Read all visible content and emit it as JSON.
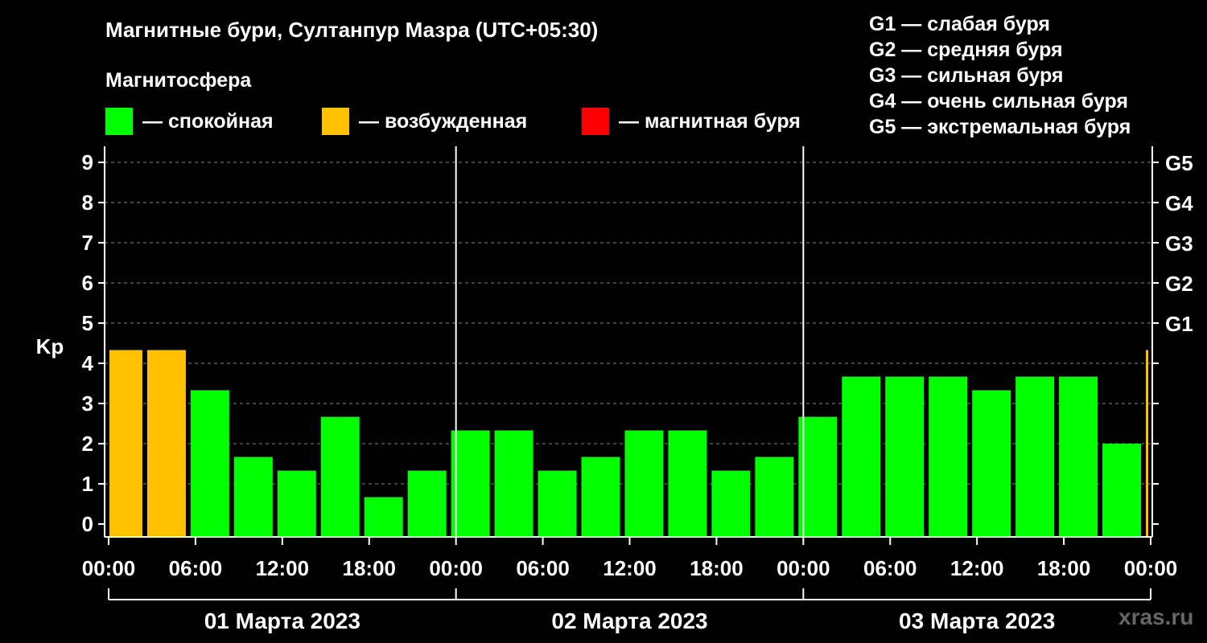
{
  "title": "Магнитные бури, Султанпур Мазра (UTC+05:30)",
  "magnetosphere": {
    "label": "Магнитосфера",
    "items": [
      {
        "label": "— спокойная",
        "color": "#00ff00"
      },
      {
        "label": "— возбужденная",
        "color": "#ffc000"
      },
      {
        "label": "— магнитная буря",
        "color": "#ff0000"
      }
    ]
  },
  "g_legend": [
    "G1 — слабая буря",
    "G2 — средняя буря",
    "G3 — сильная буря",
    "G4 — очень сильная буря",
    "G5 — экстремальная буря"
  ],
  "watermark": "xras.ru",
  "chart_data": {
    "type": "bar",
    "ylabel": "Kp",
    "ylim": [
      0,
      9
    ],
    "yticks": [
      "0",
      "1",
      "2",
      "3",
      "4",
      "5",
      "6",
      "7",
      "8",
      "9"
    ],
    "right_ticks": [
      {
        "y": 5,
        "label": "G1"
      },
      {
        "y": 6,
        "label": "G2"
      },
      {
        "y": 7,
        "label": "G3"
      },
      {
        "y": 8,
        "label": "G4"
      },
      {
        "y": 9,
        "label": "G5"
      }
    ],
    "xticks": [
      "00:00",
      "06:00",
      "12:00",
      "18:00",
      "00:00",
      "06:00",
      "12:00",
      "18:00",
      "00:00",
      "06:00",
      "12:00",
      "18:00",
      "00:00"
    ],
    "dates": [
      "01 Марта 2023",
      "02 Марта 2023",
      "03 Марта 2023"
    ],
    "grid": "dashed horizontal",
    "bars": [
      {
        "start": "01 Марта 2023 00:00",
        "end": "01 Марта 2023 02:30",
        "kp": 4.33,
        "color": "#ffc000"
      },
      {
        "start": "01 Марта 2023 02:30",
        "end": "01 Марта 2023 05:30",
        "kp": 4.33,
        "color": "#ffc000"
      },
      {
        "start": "01 Марта 2023 05:30",
        "end": "01 Марта 2023 08:30",
        "kp": 3.33,
        "color": "#00ff00"
      },
      {
        "start": "01 Марта 2023 08:30",
        "end": "01 Марта 2023 11:30",
        "kp": 1.67,
        "color": "#00ff00"
      },
      {
        "start": "01 Марта 2023 11:30",
        "end": "01 Марта 2023 14:30",
        "kp": 1.33,
        "color": "#00ff00"
      },
      {
        "start": "01 Марта 2023 14:30",
        "end": "01 Марта 2023 17:30",
        "kp": 2.67,
        "color": "#00ff00"
      },
      {
        "start": "01 Марта 2023 17:30",
        "end": "01 Марта 2023 20:30",
        "kp": 0.67,
        "color": "#00ff00"
      },
      {
        "start": "01 Марта 2023 20:30",
        "end": "01 Марта 2023 23:30",
        "kp": 1.33,
        "color": "#00ff00"
      },
      {
        "start": "01 Марта 2023 23:30",
        "end": "02 Марта 2023 02:30",
        "kp": 2.33,
        "color": "#00ff00"
      },
      {
        "start": "02 Марта 2023 02:30",
        "end": "02 Марта 2023 05:30",
        "kp": 2.33,
        "color": "#00ff00"
      },
      {
        "start": "02 Марта 2023 05:30",
        "end": "02 Марта 2023 08:30",
        "kp": 1.33,
        "color": "#00ff00"
      },
      {
        "start": "02 Марта 2023 08:30",
        "end": "02 Марта 2023 11:30",
        "kp": 1.67,
        "color": "#00ff00"
      },
      {
        "start": "02 Марта 2023 11:30",
        "end": "02 Марта 2023 14:30",
        "kp": 2.33,
        "color": "#00ff00"
      },
      {
        "start": "02 Марта 2023 14:30",
        "end": "02 Марта 2023 17:30",
        "kp": 2.33,
        "color": "#00ff00"
      },
      {
        "start": "02 Марта 2023 17:30",
        "end": "02 Марта 2023 20:30",
        "kp": 1.33,
        "color": "#00ff00"
      },
      {
        "start": "02 Марта 2023 20:30",
        "end": "02 Марта 2023 23:30",
        "kp": 1.67,
        "color": "#00ff00"
      },
      {
        "start": "02 Марта 2023 23:30",
        "end": "03 Марта 2023 02:30",
        "kp": 2.67,
        "color": "#00ff00"
      },
      {
        "start": "03 Марта 2023 02:30",
        "end": "03 Марта 2023 05:30",
        "kp": 3.67,
        "color": "#00ff00"
      },
      {
        "start": "03 Марта 2023 05:30",
        "end": "03 Марта 2023 08:30",
        "kp": 3.67,
        "color": "#00ff00"
      },
      {
        "start": "03 Марта 2023 08:30",
        "end": "03 Марта 2023 11:30",
        "kp": 3.67,
        "color": "#00ff00"
      },
      {
        "start": "03 Марта 2023 11:30",
        "end": "03 Марта 2023 14:30",
        "kp": 3.33,
        "color": "#00ff00"
      },
      {
        "start": "03 Марта 2023 14:30",
        "end": "03 Марта 2023 17:30",
        "kp": 3.67,
        "color": "#00ff00"
      },
      {
        "start": "03 Марта 2023 17:30",
        "end": "03 Марта 2023 20:30",
        "kp": 3.67,
        "color": "#00ff00"
      },
      {
        "start": "03 Марта 2023 20:30",
        "end": "03 Марта 2023 23:30",
        "kp": 2.0,
        "color": "#00ff00"
      },
      {
        "start": "03 Марта 2023 23:30",
        "end": "04 Марта 2023 00:00",
        "kp": 4.33,
        "color": "#ffc000"
      }
    ]
  }
}
